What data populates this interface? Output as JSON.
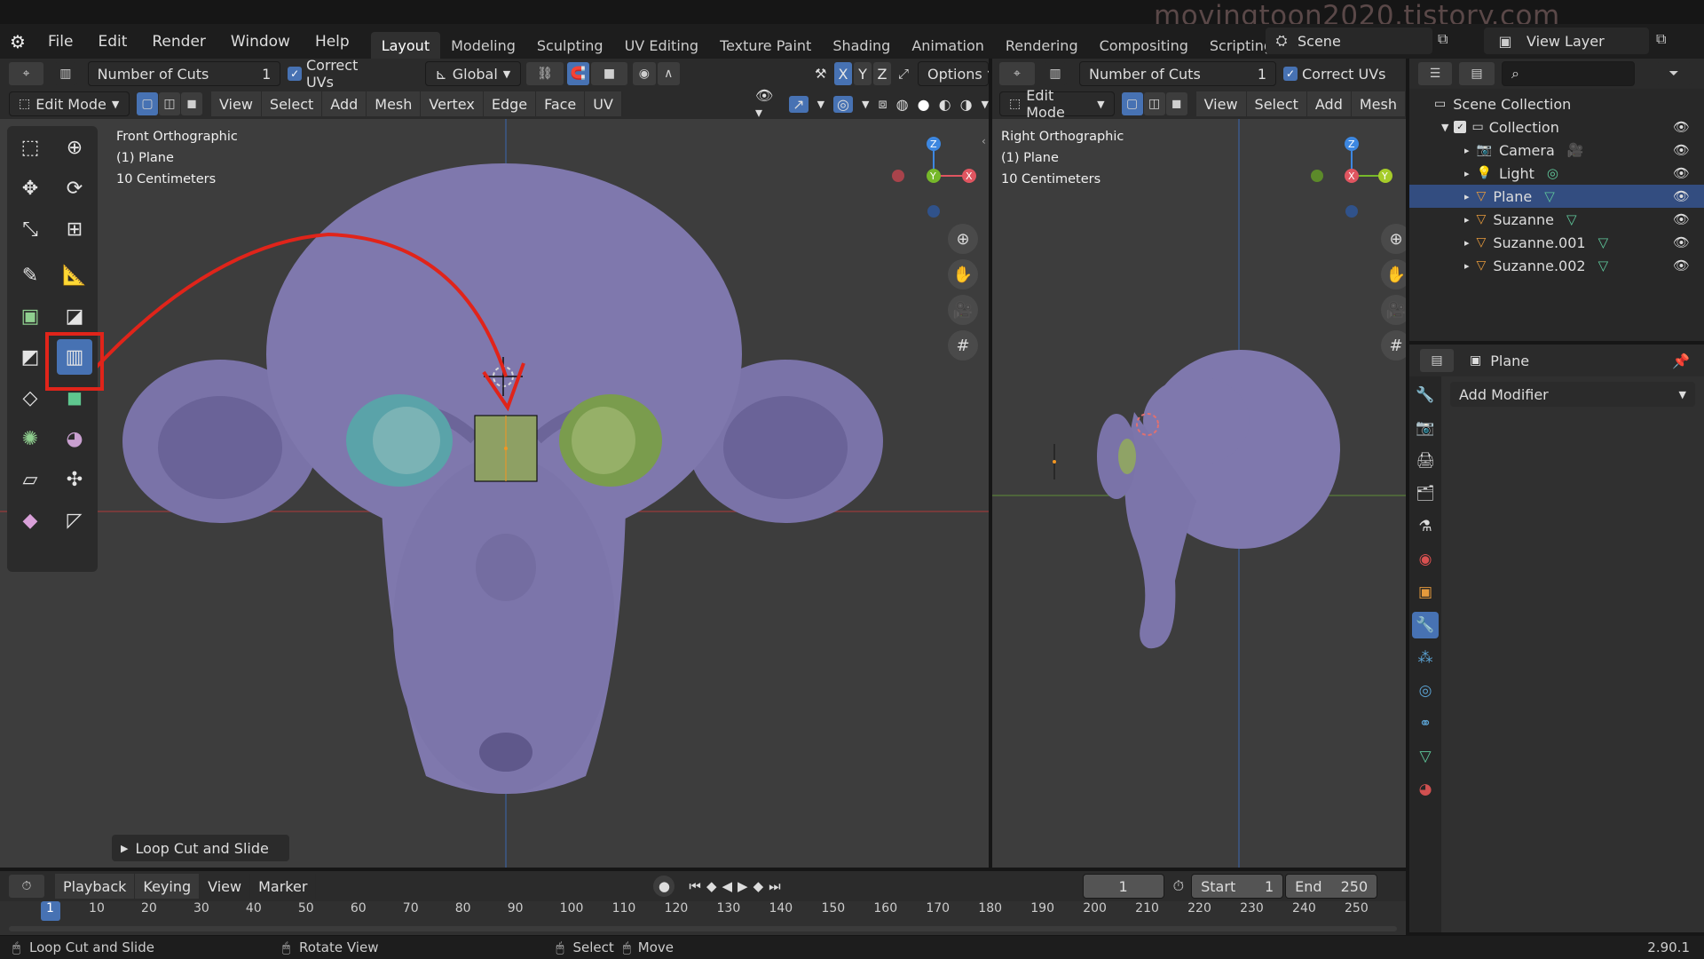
{
  "watermark": "movingtoon2020.tistory.com",
  "menu": [
    "File",
    "Edit",
    "Render",
    "Window",
    "Help"
  ],
  "workspaces": [
    "Layout",
    "Modeling",
    "Sculpting",
    "UV Editing",
    "Texture Paint",
    "Shading",
    "Animation",
    "Rendering",
    "Compositing",
    "Scripting"
  ],
  "scene": {
    "name": "Scene",
    "view_layer": "View Layer"
  },
  "tool_header": {
    "cuts_label": "Number of Cuts",
    "cuts_value": "1",
    "correct_uvs": "Correct UVs",
    "orientation": "Global",
    "axes": [
      "X",
      "Y",
      "Z"
    ],
    "options": "Options"
  },
  "left_header": {
    "mode": "Edit Mode",
    "menus": [
      "View",
      "Select",
      "Add",
      "Mesh",
      "Vertex",
      "Edge",
      "Face",
      "UV"
    ]
  },
  "right_header": {
    "mode": "Edit Mode",
    "menus": [
      "View",
      "Select",
      "Add",
      "Mesh"
    ]
  },
  "left_vp": {
    "view": "Front Orthographic",
    "object": "(1) Plane",
    "scale": "10 Centimeters"
  },
  "right_vp": {
    "view": "Right Orthographic",
    "object": "(1) Plane",
    "scale": "10 Centimeters"
  },
  "gizmo": {
    "z": "Z",
    "y": "Y",
    "x": "X"
  },
  "operator_panel": "Loop Cut and Slide",
  "outliner": {
    "root": "Scene Collection",
    "collection": "Collection",
    "items": [
      "Camera",
      "Light",
      "Plane",
      "Suzanne",
      "Suzanne.001",
      "Suzanne.002"
    ],
    "selected": "Plane"
  },
  "properties": {
    "object": "Plane",
    "add_modifier": "Add Modifier"
  },
  "timeline": {
    "menus": [
      "Playback",
      "Keying",
      "View",
      "Marker"
    ],
    "current": "1",
    "start_label": "Start",
    "start": "1",
    "end_label": "End",
    "end": "250",
    "ticks": [
      "1",
      "10",
      "20",
      "30",
      "40",
      "50",
      "60",
      "70",
      "80",
      "90",
      "100",
      "110",
      "120",
      "130",
      "140",
      "150",
      "160",
      "170",
      "180",
      "190",
      "200",
      "210",
      "220",
      "230",
      "240",
      "250"
    ]
  },
  "status": {
    "left": "Loop Cut and Slide",
    "mid": "Rotate View",
    "select": "Select",
    "move": "Move",
    "version": "2.90.1"
  },
  "colors": {
    "accent": "#4772b3",
    "highlight_box": "#e0241a",
    "annotation_arrow": "#e0241a"
  }
}
